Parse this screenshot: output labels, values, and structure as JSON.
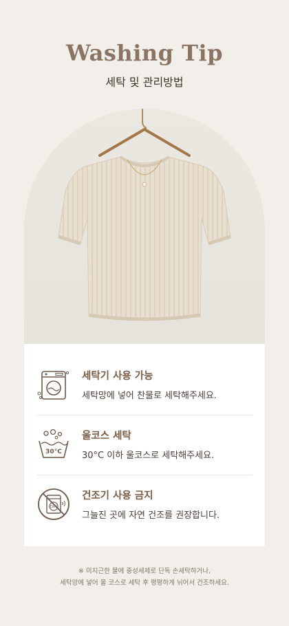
{
  "header": {
    "title": "Washing Tip",
    "subtitle": "세탁 및 관리방법"
  },
  "product_image": {
    "description_icon": "knit-sweater-on-hanger"
  },
  "care_items": [
    {
      "icon": "washing-machine-icon",
      "title": "세탁기 사용 가능",
      "desc": "세탁망에 넣어 찬물로 세탁해주세요."
    },
    {
      "icon": "wool-course-wash-icon",
      "title": "울코스 세탁",
      "desc": "30°C 이하 울코스로 세탁해주세요.",
      "icon_label": "30°C"
    },
    {
      "icon": "no-dryer-icon",
      "title": "건조기 사용 금지",
      "desc": "그늘진 곳에 자연 건조를 권장합니다.",
      "icon_label": "DRY"
    }
  ],
  "footnote": {
    "line1": "※ 미지근한 물에 중성세제로 단독 손세탁하거나,",
    "line2": "세탁망에 넣어 울 코스로 세탁 후 평평하게 뉘어서 건조하세요."
  },
  "colors": {
    "background": "#f2efea",
    "accent": "#8a7463",
    "item_title": "#7a5c47",
    "card": "#ffffff"
  }
}
